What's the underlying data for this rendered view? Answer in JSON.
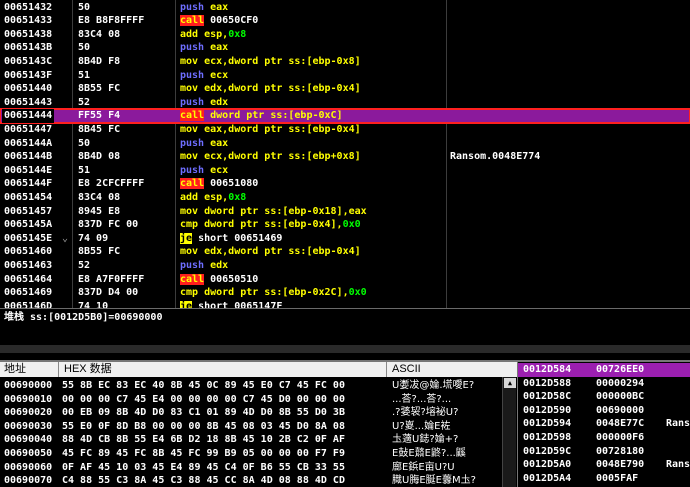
{
  "disassembly": [
    {
      "addr": "00651432",
      "hex": "50",
      "mn": "push",
      "ops": [
        [
          "op",
          "eax"
        ]
      ]
    },
    {
      "addr": "00651433",
      "hex": "E8 B8F8FFFF",
      "mn": "call",
      "ops": [
        [
          "op-call",
          "00650CF0"
        ]
      ]
    },
    {
      "addr": "00651438",
      "hex": "83C4 08",
      "mn": "add",
      "ops": [
        [
          "op",
          "esp,"
        ],
        [
          "num",
          "0x8"
        ]
      ]
    },
    {
      "addr": "0065143B",
      "hex": "50",
      "mn": "push",
      "ops": [
        [
          "op",
          "eax"
        ]
      ]
    },
    {
      "addr": "0065143C",
      "hex": "8B4D F8",
      "mn": "mov",
      "ops": [
        [
          "op",
          "ecx,dword ptr ss:[ebp-0x8]"
        ]
      ]
    },
    {
      "addr": "0065143F",
      "hex": "51",
      "mn": "push",
      "ops": [
        [
          "op",
          "ecx"
        ]
      ]
    },
    {
      "addr": "00651440",
      "hex": "8B55 FC",
      "mn": "mov",
      "ops": [
        [
          "op",
          "edx,dword ptr ss:[ebp-0x4]"
        ]
      ]
    },
    {
      "addr": "00651443",
      "hex": "52",
      "mn": "push",
      "ops": [
        [
          "op",
          "edx"
        ]
      ]
    },
    {
      "addr": "00651444",
      "hex": "FF55 F4",
      "mn": "call",
      "ops": [
        [
          "op-sel",
          "dword ptr ss:[ebp-0xC]"
        ]
      ],
      "selected": true
    },
    {
      "addr": "00651447",
      "hex": "8B45 FC",
      "mn": "mov",
      "ops": [
        [
          "op",
          "eax,dword ptr ss:[ebp-0x4]"
        ]
      ]
    },
    {
      "addr": "0065144A",
      "hex": "50",
      "mn": "push",
      "ops": [
        [
          "op",
          "eax"
        ]
      ]
    },
    {
      "addr": "0065144B",
      "hex": "8B4D 08",
      "mn": "mov",
      "ops": [
        [
          "op",
          "ecx,dword ptr ss:[ebp+0x8]"
        ]
      ],
      "comment": "Ransom.0048E774"
    },
    {
      "addr": "0065144E",
      "hex": "51",
      "mn": "push",
      "ops": [
        [
          "op",
          "ecx"
        ]
      ]
    },
    {
      "addr": "0065144F",
      "hex": "E8 2CFCFFFF",
      "mn": "call",
      "ops": [
        [
          "op-call",
          "00651080"
        ]
      ]
    },
    {
      "addr": "00651454",
      "hex": "83C4 08",
      "mn": "add",
      "ops": [
        [
          "op",
          "esp,"
        ],
        [
          "num",
          "0x8"
        ]
      ]
    },
    {
      "addr": "00651457",
      "hex": "8945 E8",
      "mn": "mov",
      "ops": [
        [
          "op",
          "dword ptr ss:[ebp-0x18],eax"
        ]
      ]
    },
    {
      "addr": "0065145A",
      "hex": "837D FC 00",
      "mn": "cmp",
      "ops": [
        [
          "op",
          "dword ptr ss:[ebp-0x4],"
        ],
        [
          "num",
          "0x0"
        ]
      ]
    },
    {
      "addr": "0065145E",
      "hex": "74 09",
      "mn": "je",
      "ops": [
        [
          "op-call",
          "short 00651469"
        ]
      ],
      "jmpmark": "⌄"
    },
    {
      "addr": "00651460",
      "hex": "8B55 FC",
      "mn": "mov",
      "ops": [
        [
          "op",
          "edx,dword ptr ss:[ebp-0x4]"
        ]
      ]
    },
    {
      "addr": "00651463",
      "hex": "52",
      "mn": "push",
      "ops": [
        [
          "op",
          "edx"
        ]
      ]
    },
    {
      "addr": "00651464",
      "hex": "E8 A7F0FFFF",
      "mn": "call",
      "ops": [
        [
          "op-call",
          "00650510"
        ]
      ]
    },
    {
      "addr": "00651469",
      "hex": "837D D4 00",
      "mn": "cmp",
      "ops": [
        [
          "op",
          "dword ptr ss:[ebp-0x2C],"
        ],
        [
          "num",
          "0x0"
        ]
      ]
    },
    {
      "addr": "0065146D",
      "hex": "74 10",
      "mn": "je",
      "ops": [
        [
          "op-call",
          "short 0065147F"
        ]
      ]
    }
  ],
  "info_line": "堆栈 ss:[0012D5B0]=00690000",
  "dump": {
    "header": {
      "addr": "地址",
      "hex": "HEX 数据",
      "ascii": "ASCII"
    },
    "rows": [
      {
        "addr": "00690000",
        "hex": "55 8B EC 83 EC 40 8B 45 0C 89 45 E0 C7 45 FC 00",
        "ascii": "U嬱冹@婨.塃噯E?"
      },
      {
        "addr": "00690010",
        "hex": "00 00 00 C7 45 E4 00 00 00 00 C7 45 D0 00 00 00",
        "ascii": "...荅?...荅?..."
      },
      {
        "addr": "00690020",
        "hex": "00 EB 09 8B 4D D0 83 C1 01 89 4D D0 8B 55 D0 3B",
        "ascii": ".?婱袃?塎袐U?"
      },
      {
        "addr": "00690030",
        "hex": "55 E0 0F 8D B8 00 00 00 8B 45 08 03 45 D0 8A 08",
        "ascii": "U?嵏...婨E袏"
      },
      {
        "addr": "00690040",
        "hex": "88 4D CB 8B 55 E4 6B D2 18 8B 45 10 2B C2 0F AF",
        "ascii": "圡藡U鋕?婨+?"
      },
      {
        "addr": "00690050",
        "hex": "45 FC 89 45 FC 8B 45 FC 99 B9 05 00 00 00 F7 F9",
        "ascii": "E鼔E鼘E鼨?...鼷"
      },
      {
        "addr": "00690060",
        "hex": "0F AF 45 10 03 45 E4 89 45 C4 0F B6 55 CB 33 55",
        "ascii": "廍E鋲E亩U?U"
      },
      {
        "addr": "00690070",
        "hex": "C4 88 55 C3 8A 45 C3 88 45 CC 8A 4D 08 88 4D CD",
        "ascii": "膱U脢E脠E虋M圡?"
      }
    ]
  },
  "stack": [
    {
      "addr": "0012D584",
      "value": "00726EE0",
      "comment": "",
      "current": true
    },
    {
      "addr": "0012D588",
      "value": "00000294",
      "comment": ""
    },
    {
      "addr": "0012D58C",
      "value": "000000BC",
      "comment": ""
    },
    {
      "addr": "0012D590",
      "value": "00690000",
      "comment": ""
    },
    {
      "addr": "0012D594",
      "value": "0048E77C",
      "comment": "Ransom"
    },
    {
      "addr": "0012D598",
      "value": "000000F6",
      "comment": ""
    },
    {
      "addr": "0012D59C",
      "value": "00728180",
      "comment": ""
    },
    {
      "addr": "0012D5A0",
      "value": "0048E790",
      "comment": "Ransom"
    },
    {
      "addr": "0012D5A4",
      "value": "0005FAF",
      "comment": ""
    }
  ]
}
